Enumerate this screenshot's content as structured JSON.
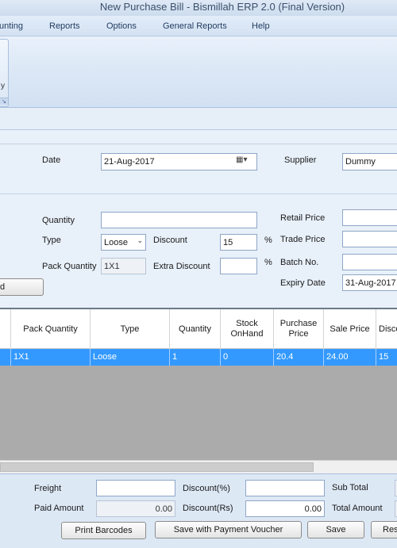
{
  "window": {
    "title": "New Purchase Bill - Bismillah ERP 2.0  (Final Version)"
  },
  "menu": [
    "unting",
    "Reports",
    "Options",
    "General Reports",
    "Help"
  ],
  "ribbon": {
    "partial_label": "y"
  },
  "form": {
    "date_label": "Date",
    "date_value": "21-Aug-2017",
    "supplier_label": "Supplier",
    "supplier_value": "Dummy",
    "quantity_label": "Quantity",
    "quantity_value": "",
    "type_label": "Type",
    "type_value": "Loose",
    "discount_label": "Discount",
    "discount_value": "15",
    "percent_symbol": "%",
    "pack_quantity_label": "Pack Quantity",
    "pack_quantity_value": "1X1",
    "extra_discount_label": "Extra Discount",
    "extra_discount_value": "",
    "retail_price_label": "Retail Price",
    "retail_price_value": "",
    "trade_price_label": "Trade Price",
    "trade_price_value": "",
    "batch_no_label": "Batch No.",
    "batch_no_value": "",
    "expiry_date_label": "Expiry Date",
    "expiry_date_value": "31-Aug-2017",
    "add_button_label": "d"
  },
  "grid": {
    "columns": [
      "Pack Quantity",
      "Type",
      "Quantity",
      "Stock OnHand",
      "Purchase Price",
      "Sale Price",
      "Disco"
    ],
    "rows": [
      [
        "1X1",
        "Loose",
        "1",
        "0",
        "20.4",
        "24.00",
        "15"
      ]
    ]
  },
  "footer": {
    "freight_label": "Freight",
    "freight_value": "",
    "discount_pct_label": "Discount(%)",
    "discount_pct_value": "",
    "sub_total_label": "Sub Total",
    "paid_amount_label": "Paid Amount",
    "paid_amount_value": "0.00",
    "discount_rs_label": "Discount(Rs)",
    "discount_rs_value": "0.00",
    "total_amount_label": "Total Amount",
    "print_barcodes_label": "Print Barcodes",
    "save_with_voucher_label": "Save with Payment Voucher",
    "save_label": "Save",
    "reset_label": "Res"
  }
}
